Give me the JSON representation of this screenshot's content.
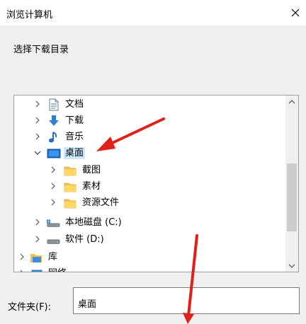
{
  "window": {
    "title": "浏览计算机"
  },
  "instruction": "选择下载目录",
  "tree": {
    "items": [
      {
        "label": "文档",
        "icon": "document-icon"
      },
      {
        "label": "下载",
        "icon": "download-arrow-icon"
      },
      {
        "label": "音乐",
        "icon": "music-note-icon"
      },
      {
        "label": "桌面",
        "icon": "desktop-icon",
        "expanded": true,
        "selected": true
      },
      {
        "label": "截图",
        "icon": "folder-icon"
      },
      {
        "label": "素材",
        "icon": "folder-icon"
      },
      {
        "label": "资源文件",
        "icon": "folder-icon"
      },
      {
        "label": "本地磁盘 (C:)",
        "icon": "windows-drive-icon"
      },
      {
        "label": "软件 (D:)",
        "icon": "drive-icon"
      },
      {
        "label": "库",
        "icon": "library-icon"
      },
      {
        "label": "网络",
        "icon": "network-icon"
      }
    ]
  },
  "folder_field": {
    "label": "文件夹(F):",
    "value": "桌面"
  },
  "colors": {
    "selection": "#cce8ff",
    "annotation_arrow": "#e0201a",
    "folder": "#f6c24a"
  }
}
